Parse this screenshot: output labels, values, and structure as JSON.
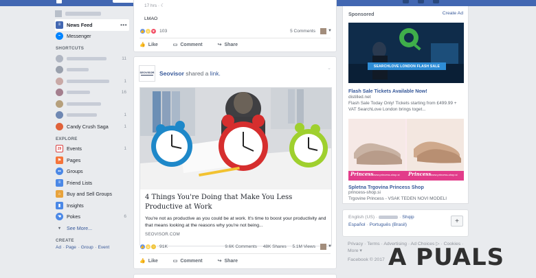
{
  "sidebar": {
    "news_feed": "News Feed",
    "messenger": "Messenger",
    "shortcuts_header": "SHORTCUTS",
    "shortcuts": [
      {
        "count": "11"
      },
      {
        "count": ""
      },
      {
        "count": "1"
      },
      {
        "count": "16"
      },
      {
        "count": ""
      },
      {
        "count": "1"
      },
      {
        "label": "Candy Crush Saga",
        "count": "1"
      }
    ],
    "explore_header": "EXPLORE",
    "explore": [
      {
        "label": "Events",
        "count": "1",
        "icon": "calendar-icon",
        "badge": "29"
      },
      {
        "label": "Pages",
        "count": "",
        "icon": "flag-icon"
      },
      {
        "label": "Groups",
        "count": "",
        "icon": "groups-icon"
      },
      {
        "label": "Friend Lists",
        "count": "",
        "icon": "friend-list-icon"
      },
      {
        "label": "Buy and Sell Groups",
        "count": "",
        "icon": "shop-icon"
      },
      {
        "label": "Insights",
        "count": "",
        "icon": "insights-icon"
      },
      {
        "label": "Pokes",
        "count": "6",
        "icon": "poke-icon"
      }
    ],
    "see_more": "See More...",
    "create_header": "CREATE",
    "create_links": [
      "Ad",
      "Page",
      "Group",
      "Event"
    ]
  },
  "post1": {
    "time": "17 hrs",
    "text": "LMAO",
    "reaction_count": "103",
    "comments": "5 Comments",
    "like": "Like",
    "comment": "Comment",
    "share": "Share"
  },
  "post2": {
    "author": "Seovisor",
    "action": "shared a",
    "link_word": "link.",
    "logo_text": "SEOVISOR",
    "link_title": "4 Things You're Doing that Make You Less Productive at Work",
    "link_desc": "You're not as productive as you could be at work. It's time to boost your productivity and that means looking at the reasons why you're not being...",
    "link_domain": "SEOVISOR.COM",
    "reaction_count": "91K",
    "comments": "9.6K Comments",
    "shares": "48K Shares",
    "views": "5.1M Views",
    "like": "Like",
    "comment": "Comment",
    "share": "Share"
  },
  "ads": {
    "header": "Sponsored",
    "create_ad": "Create Ad",
    "ad1": {
      "banner": "SEARCHLOVE LONDON FLASH SALE",
      "title": "Flash Sale Tickets Available Now!",
      "domain": "distilled.net",
      "desc": "Flash Sale Today Only! Tickets starting from £499.99 + VAT SearchLove London brings toget..."
    },
    "ad2": {
      "title": "Spletna Trgovina Princess Shop",
      "domain": "princess-shop.si",
      "desc": "Trgovine Princess - VSAK TEDEN NOVI MODELI",
      "brand": "Princess",
      "site": "www.princess-shop.si"
    }
  },
  "languages": {
    "line1": [
      "English (US)",
      "Shqip"
    ],
    "line2": [
      "Español",
      "Português (Brasil)"
    ]
  },
  "footer": {
    "links": "Privacy · Terms · Advertising · Ad Choices ▷ · Cookies · More ▾",
    "copyright": "Facebook © 2017"
  },
  "watermark": "A PUALS",
  "colors": {
    "brand_blue": "#4267b2",
    "link_blue": "#365899",
    "background": "#e9ebee"
  }
}
